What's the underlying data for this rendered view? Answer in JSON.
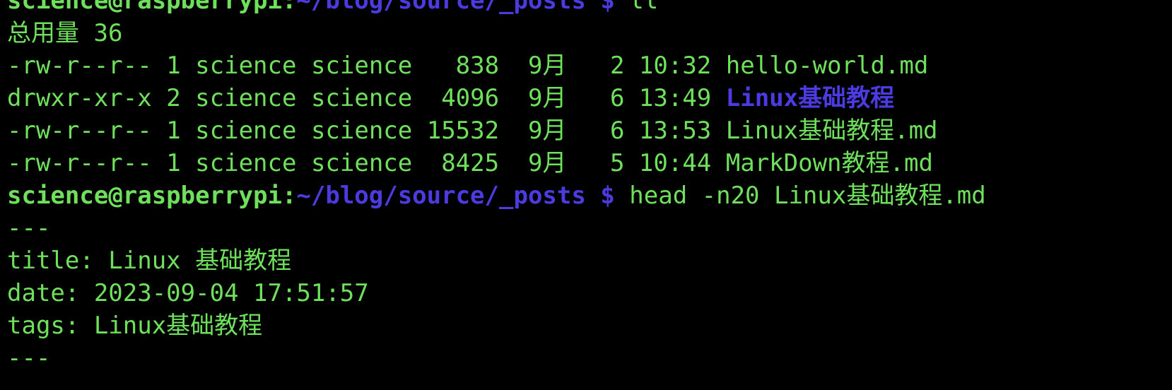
{
  "colors": {
    "background": "#000000",
    "text": "#6fe05c",
    "prompt_path": "#4b3be0",
    "directory": "#4b3be0"
  },
  "prompt": {
    "user_host": "science@raspberrypi",
    "separator": ":",
    "path": "~/blog/source/_posts",
    "dollar": "$"
  },
  "lines": {
    "prev_command": "ll",
    "total": "总用量 36",
    "files": [
      {
        "perms": "-rw-r--r--",
        "links": "1",
        "owner": "science",
        "group": "science",
        "size": "  838",
        "month": "9月",
        "day": " 2",
        "time": "10:32",
        "name": "hello-world.md",
        "is_dir": false
      },
      {
        "perms": "drwxr-xr-x",
        "links": "2",
        "owner": "science",
        "group": "science",
        "size": " 4096",
        "month": "9月",
        "day": " 6",
        "time": "13:49",
        "name": "Linux基础教程",
        "is_dir": true
      },
      {
        "perms": "-rw-r--r--",
        "links": "1",
        "owner": "science",
        "group": "science",
        "size": "15532",
        "month": "9月",
        "day": " 6",
        "time": "13:53",
        "name": "Linux基础教程.md",
        "is_dir": false
      },
      {
        "perms": "-rw-r--r--",
        "links": "1",
        "owner": "science",
        "group": "science",
        "size": " 8425",
        "month": "9月",
        "day": " 5",
        "time": "10:44",
        "name": "MarkDown教程.md",
        "is_dir": false
      }
    ],
    "current_command": "head -n20 Linux基础教程.md",
    "output": [
      "---",
      "title: Linux 基础教程",
      "date: 2023-09-04 17:51:57",
      "tags: Linux基础教程",
      "---"
    ]
  }
}
